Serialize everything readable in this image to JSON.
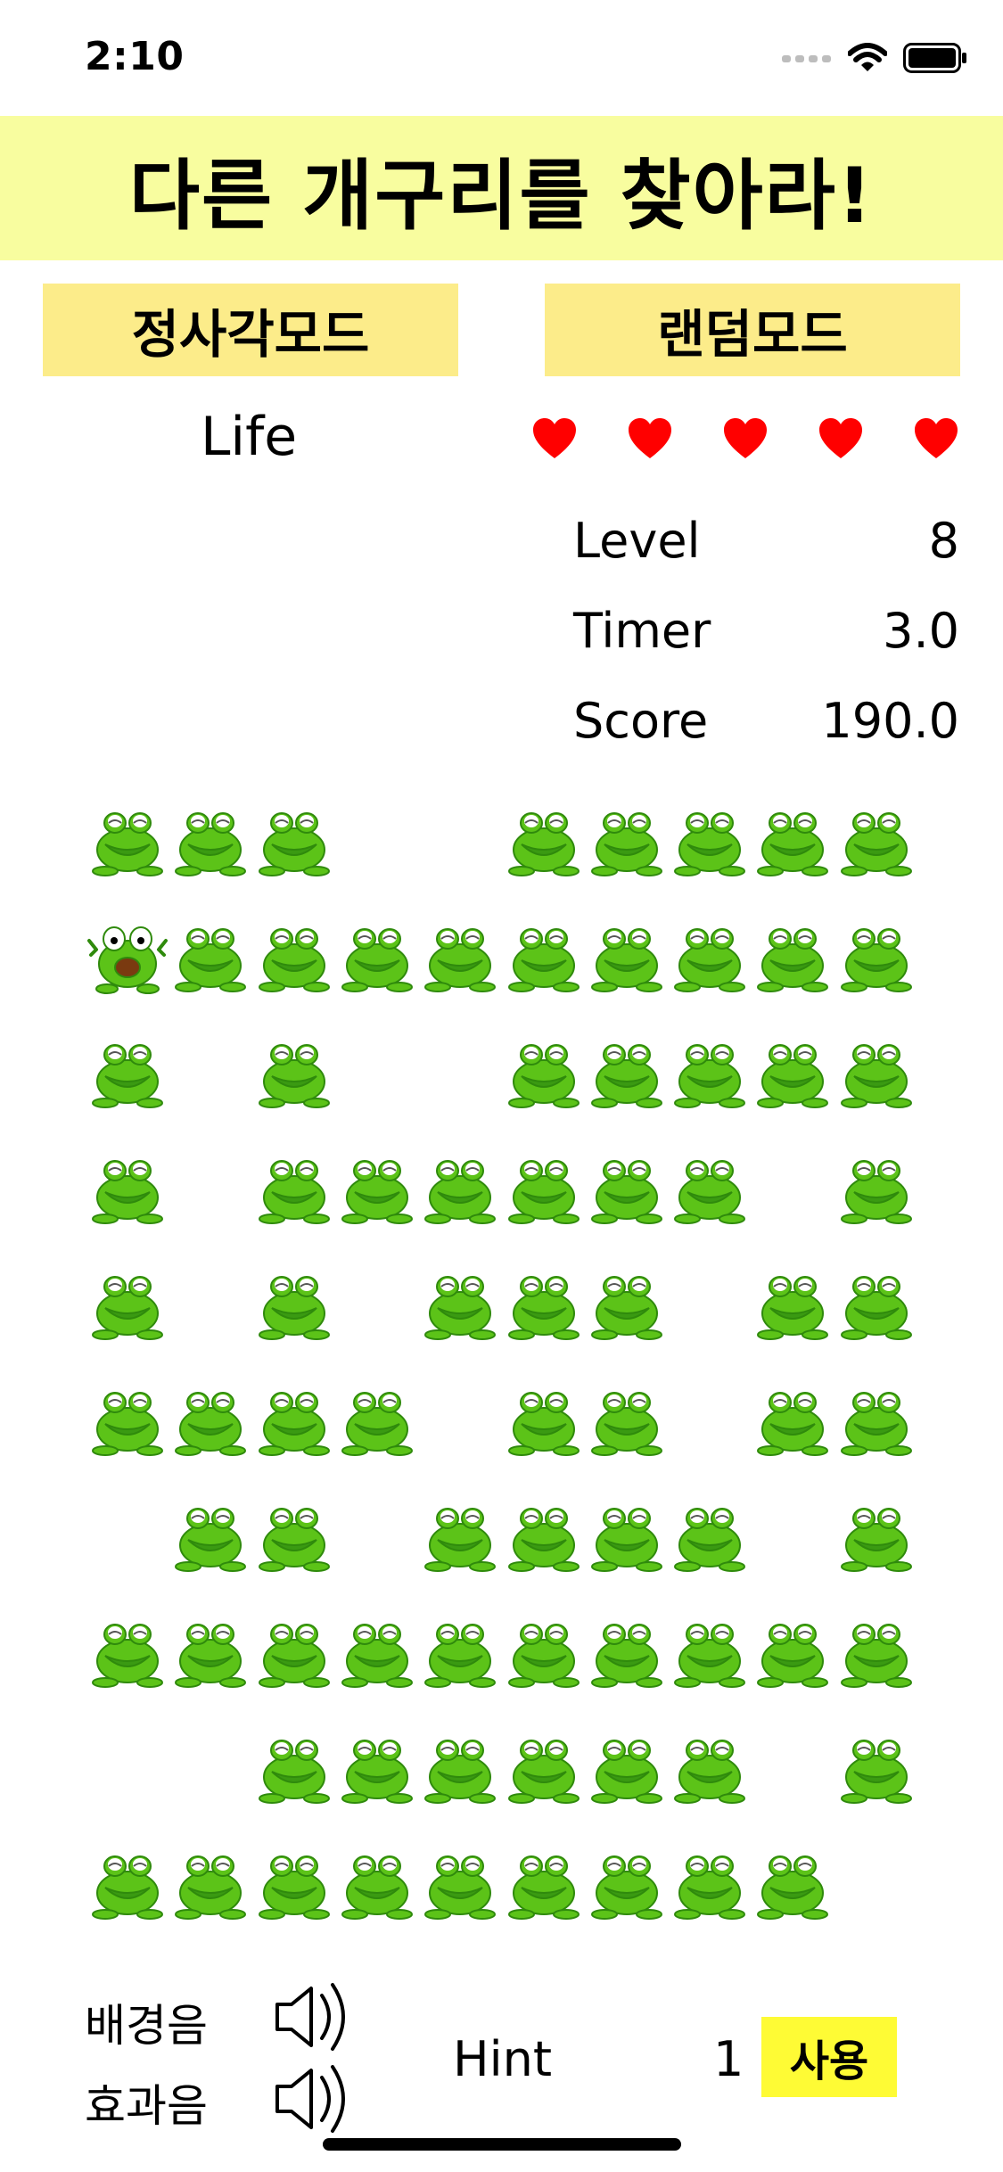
{
  "status_bar": {
    "time": "2:10"
  },
  "title": "다른 개구리를 찾아라!",
  "modes": {
    "square_label": "정사각모드",
    "random_label": "랜덤모드"
  },
  "life": {
    "label": "Life",
    "hearts": 5
  },
  "stats": {
    "level_label": "Level",
    "level_value": "8",
    "timer_label": "Timer",
    "timer_value": "3.0",
    "score_label": "Score",
    "score_value": "190.0"
  },
  "frog_grid": {
    "columns": 10,
    "rows": [
      "nnn..nnnnn",
      "snnnnnnnnn",
      "n.n..nnnnn",
      "n.nnnnnn.n",
      "n.n.nnn.nn",
      "nnnn.nn.nn",
      ".nn.nnnn.n",
      "nnnnnnnnnn",
      "..nnnnnn.n",
      "nnnnnnnnn."
    ],
    "legend": {
      "n": "normal-frog",
      "s": "surprised-frog",
      ".": "empty"
    }
  },
  "sound": {
    "bgm_label": "배경음",
    "sfx_label": "효과음"
  },
  "hint": {
    "label": "Hint",
    "count": "1",
    "use_label": "사용"
  },
  "colors": {
    "title_bg": "#f8fd9f",
    "mode_button_bg": "#fcec8a",
    "heart": "#ff0000",
    "use_button_bg": "#fefb35",
    "frog_green": "#5cc318"
  }
}
